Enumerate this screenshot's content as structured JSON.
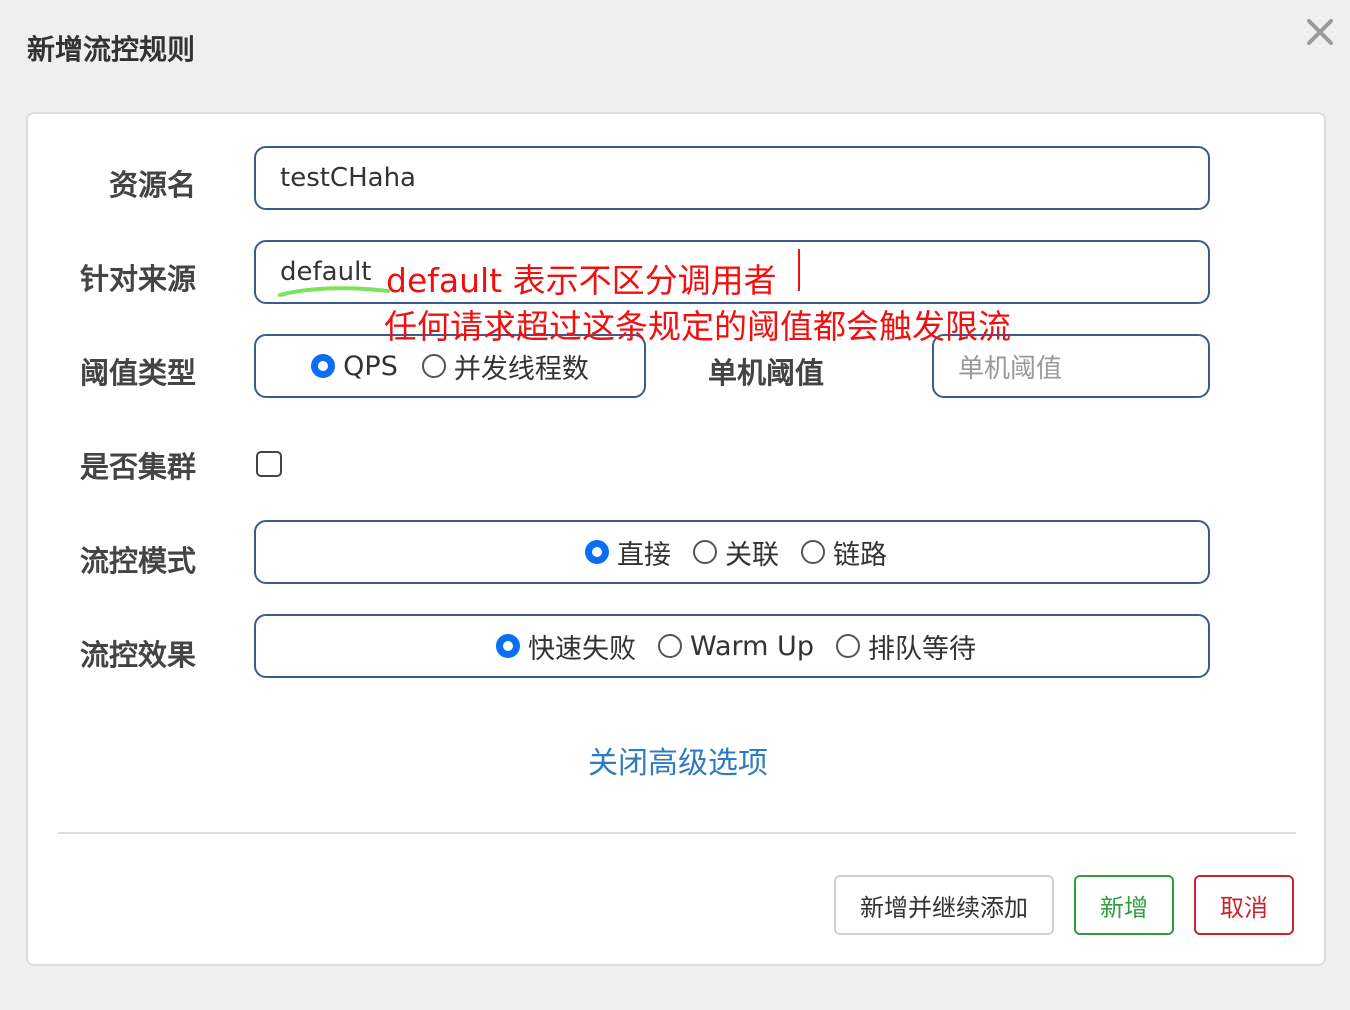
{
  "dialog": {
    "title": "新增流控规则",
    "close_icon": "close-icon"
  },
  "form": {
    "resource_label": "资源名",
    "resource_value": "testCHaha",
    "origin_label": "针对来源",
    "origin_value": "default",
    "threshold_type_label": "阈值类型",
    "threshold_type_options": [
      "QPS",
      "并发线程数"
    ],
    "threshold_type_selected": "QPS",
    "single_threshold_label": "单机阈值",
    "single_threshold_placeholder": "单机阈值",
    "cluster_label": "是否集群",
    "cluster_checked": false,
    "mode_label": "流控模式",
    "mode_options": [
      "直接",
      "关联",
      "链路"
    ],
    "mode_selected": "直接",
    "effect_label": "流控效果",
    "effect_options": [
      "快速失败",
      "Warm Up",
      "排队等待"
    ],
    "effect_selected": "快速失败",
    "advanced_link": "关闭高级选项"
  },
  "buttons": {
    "add_continue": "新增并继续添加",
    "add": "新增",
    "cancel": "取消"
  },
  "annotation": {
    "line1": "default 表示不区分调用者",
    "line2": "任何请求超过这条规定的阈值都会触发限流",
    "color": "#f01010",
    "underline_color": "#7de35a"
  },
  "colors": {
    "field_border": "#3b5a8f",
    "radio_checked": "#0b6ef5",
    "link": "#2f7bc2",
    "add_button": "#2e9e3e",
    "cancel_button": "#c9252c"
  }
}
